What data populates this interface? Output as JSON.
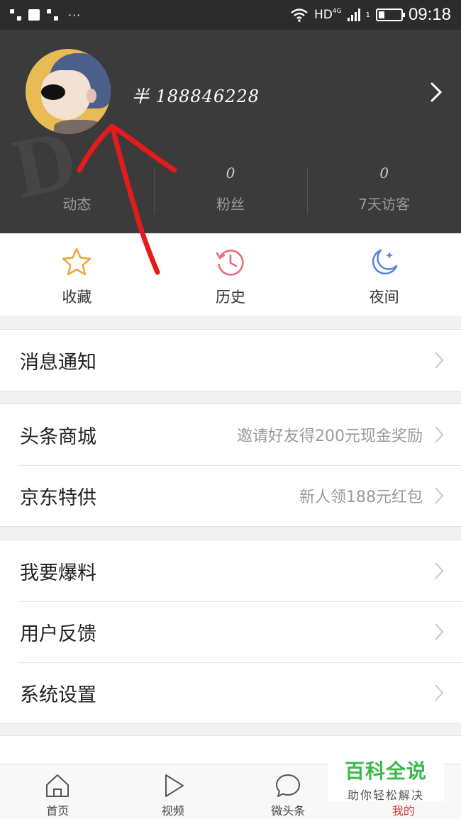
{
  "status_bar": {
    "network": "HD",
    "network_sup": "4G",
    "signal_sub": "1",
    "time": "09:18",
    "icons": [
      "grid-icon",
      "image-icon",
      "grid-icon",
      "more-dots-icon",
      "wifi-icon",
      "signal-icon",
      "battery-icon"
    ]
  },
  "profile": {
    "username": "半 188846228",
    "stats": [
      {
        "count": "",
        "label": "动态"
      },
      {
        "count": "0",
        "label": "粉丝"
      },
      {
        "count": "0",
        "label": "7天访客"
      }
    ]
  },
  "quick_actions": [
    {
      "label": "收藏",
      "icon": "star-icon",
      "color": "#f0a73a"
    },
    {
      "label": "历史",
      "icon": "history-clock-icon",
      "color": "#e96a7a"
    },
    {
      "label": "夜间",
      "icon": "moon-icon",
      "color": "#5a86d8"
    }
  ],
  "menu_groups": [
    [
      {
        "title": "消息通知",
        "sub": ""
      }
    ],
    [
      {
        "title": "头条商城",
        "sub": "邀请好友得200元现金奖励"
      },
      {
        "title": "京东特供",
        "sub": "新人领188元红包"
      }
    ],
    [
      {
        "title": "我要爆料",
        "sub": ""
      },
      {
        "title": "用户反馈",
        "sub": ""
      },
      {
        "title": "系统设置",
        "sub": ""
      }
    ]
  ],
  "tabbar": [
    {
      "label": "首页",
      "icon": "home-icon"
    },
    {
      "label": "视频",
      "icon": "play-icon"
    },
    {
      "label": "微头条",
      "icon": "chat-bubble-icon"
    },
    {
      "label": "我的",
      "icon": "person-icon",
      "active": true
    }
  ],
  "watermark": {
    "title": "百科全说",
    "subtitle": "助你轻松解决"
  },
  "colors": {
    "header_bg": "#3b3b3b",
    "annotation": "#e51a1a",
    "active_tab": "#d43c3c"
  }
}
